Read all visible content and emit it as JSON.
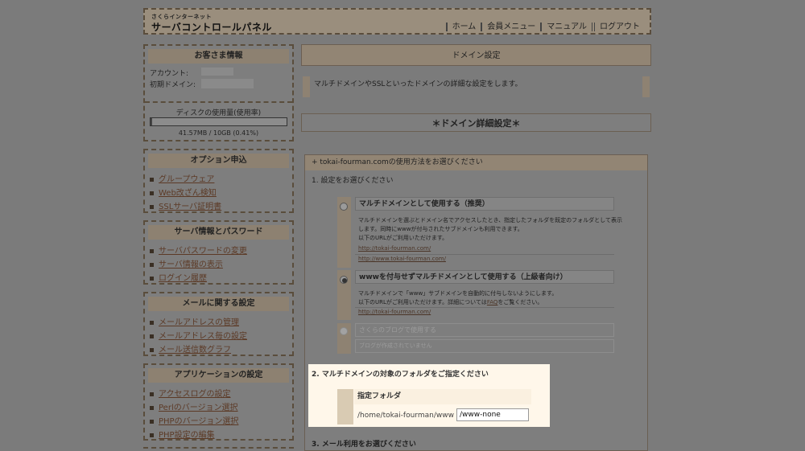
{
  "header": {
    "brand_small": "さくらインターネット",
    "brand_title": "サーバコントロールパネル",
    "nav": [
      "ホーム",
      "会員メニュー",
      "マニュアル",
      "ログアウト"
    ]
  },
  "customer": {
    "title": "お客さま情報",
    "account_label": "アカウント:",
    "domain_label": "初期ドメイン:",
    "disk_title": "ディスクの使用量(使用率)",
    "disk_usage": "41.57MB / 10GB (0.41%)",
    "disk_fraction": 0.0041
  },
  "sidebar": [
    {
      "title": "オプション申込",
      "items": [
        "グループウェア",
        "Web改ざん検知",
        "SSLサーバ証明書"
      ]
    },
    {
      "title": "サーバ情報とパスワード",
      "items": [
        "サーバパスワードの変更",
        "サーバ情報の表示",
        "ログイン履歴"
      ]
    },
    {
      "title": "メールに関する設定",
      "items": [
        "メールアドレスの管理",
        "メールアドレス毎の設定",
        "メール送信数グラフ"
      ]
    },
    {
      "title": "アプリケーションの設定",
      "items": [
        "アクセスログの設定",
        "Perlのバージョン選択",
        "PHPのバージョン選択",
        "PHP設定の編集"
      ]
    }
  ],
  "main": {
    "section_title": "ドメイン設定",
    "description": "マルチドメインやSSLといったドメインの詳細な設定をします。",
    "detail_title": "＊ドメイン詳細設定＊",
    "usage_title": "+ tokai-fourman.comの使用方法をお選びください",
    "step1": "1. 設定をお選びください",
    "option1": {
      "label": "マルチドメインとして使用する（推奨）",
      "desc1": "マルチドメインを選ぶとドメイン名でアクセスしたとき、指定したフォルダを既定のフォルダとして表示",
      "desc2": "します。同時にwwwが付与されたサブドメインも利用できます。",
      "desc3": "以下のURLがご利用いただけます。",
      "url1": "http://tokai-fourman.com/",
      "url2": "http://www.tokai-fourman.com/"
    },
    "option2": {
      "label": "wwwを付与せずマルチドメインとして使用する（上級者向け）",
      "desc1": "マルチドメインで「www」サブドメインを自動的に付与しないようにします。",
      "desc2a": "以下のURLがご利用いただけます。詳細については",
      "faq": "FAQ",
      "desc2b": "をご覧ください。",
      "url1": "http://tokai-fourman.com/"
    },
    "option3": {
      "label": "さくらのブログで使用する",
      "desc": "ブログが作成されていません"
    },
    "step2": "2. マルチドメインの対象のフォルダをご指定ください",
    "folder_label": "指定フォルダ",
    "folder_prefix": "/home/tokai-fourman/www",
    "folder_value": "/www-none",
    "step3": "3. メール利用をお選びください"
  }
}
